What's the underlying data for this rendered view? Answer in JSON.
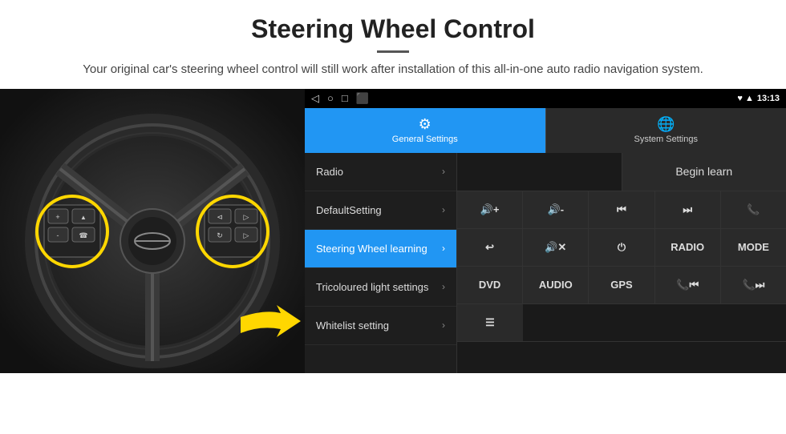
{
  "header": {
    "title": "Steering Wheel Control",
    "divider": true,
    "subtitle": "Your original car's steering wheel control will still work after installation of this all-in-one auto radio navigation system."
  },
  "statusBar": {
    "nav": [
      "◁",
      "○",
      "□",
      "⬛"
    ],
    "time": "13:13",
    "icons": "♥ ▲"
  },
  "tabs": [
    {
      "label": "General Settings",
      "icon": "⚙",
      "active": true
    },
    {
      "label": "System Settings",
      "icon": "🌐",
      "active": false
    }
  ],
  "menuItems": [
    {
      "label": "Radio",
      "active": false
    },
    {
      "label": "DefaultSetting",
      "active": false
    },
    {
      "label": "Steering Wheel learning",
      "active": true
    },
    {
      "label": "Tricoloured light settings",
      "active": false
    },
    {
      "label": "Whitelist setting",
      "active": false
    }
  ],
  "controls": {
    "beginLearn": "Begin learn",
    "rows": [
      [
        {
          "icon": "🔊+",
          "label": "vol-up"
        },
        {
          "icon": "🔊-",
          "label": "vol-down"
        },
        {
          "icon": "⏮",
          "label": "prev"
        },
        {
          "icon": "⏭",
          "label": "next"
        },
        {
          "icon": "📞",
          "label": "call"
        }
      ],
      [
        {
          "icon": "📞↩",
          "label": "hang-up"
        },
        {
          "icon": "🔊✕",
          "label": "mute"
        },
        {
          "icon": "⏻",
          "label": "power"
        },
        {
          "text": "RADIO",
          "label": "radio"
        },
        {
          "text": "MODE",
          "label": "mode"
        }
      ],
      [
        {
          "text": "DVD",
          "label": "dvd"
        },
        {
          "text": "AUDIO",
          "label": "audio"
        },
        {
          "text": "GPS",
          "label": "gps"
        },
        {
          "icon": "📞⏮",
          "label": "call-prev"
        },
        {
          "icon": "📞⏭",
          "label": "call-next"
        }
      ],
      [
        {
          "icon": "≡",
          "label": "menu"
        }
      ]
    ]
  }
}
